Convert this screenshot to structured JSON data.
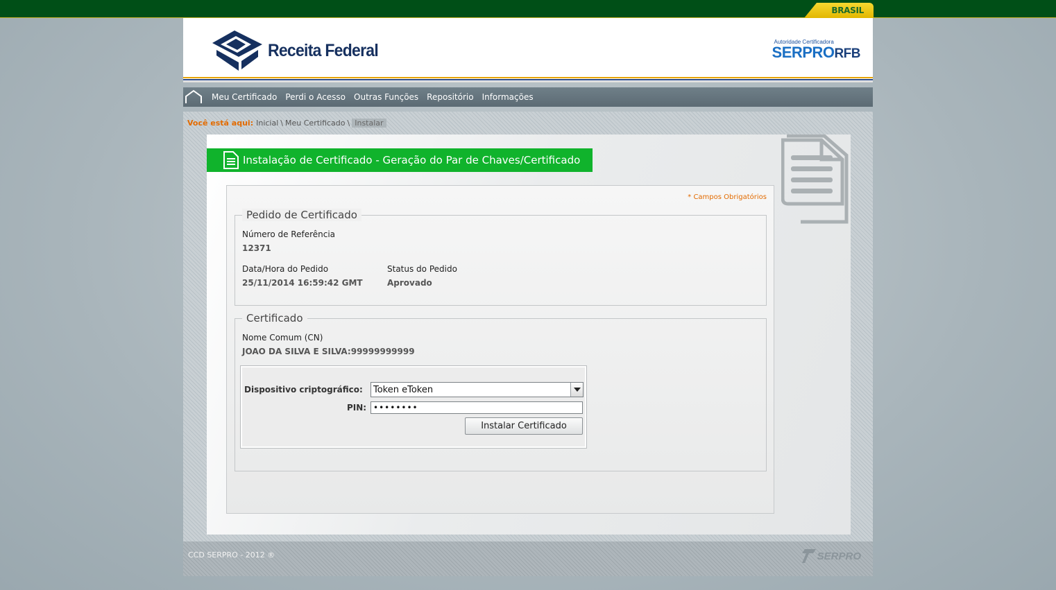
{
  "gov_bar": {
    "label": "BRASIL"
  },
  "header": {
    "logo_text": "Receita Federal",
    "serpro_subtitle": "Autoridade Certificadora",
    "serpro_brand_a": "SERPRO",
    "serpro_brand_b": "RFB"
  },
  "nav": {
    "items": [
      {
        "label": "Meu Certificado"
      },
      {
        "label": "Perdi o Acesso"
      },
      {
        "label": "Outras Funções"
      },
      {
        "label": "Repositório"
      },
      {
        "label": "Informações"
      }
    ]
  },
  "breadcrumb": {
    "label": "Você está aqui:",
    "items": [
      "Inicial",
      "Meu Certificado",
      "Instalar"
    ],
    "separator": "\\"
  },
  "page": {
    "title": "Instalação de Certificado - Geração do Par de Chaves/Certificado",
    "required_note": "* Campos Obrigatórios"
  },
  "pedido": {
    "legend": "Pedido de Certificado",
    "ref_label": "Número de Referência",
    "ref_value": "12371",
    "date_label": "Data/Hora do Pedido",
    "date_value": "25/11/2014 16:59:42 GMT",
    "status_label": "Status do Pedido",
    "status_value": "Aprovado"
  },
  "certificado": {
    "legend": "Certificado",
    "cn_label": "Nome Comum (CN)",
    "cn_value": "JOAO DA SILVA E SILVA:99999999999"
  },
  "crypto": {
    "device_label": "Dispositivo criptográfico:",
    "device_value": "Token eToken",
    "pin_label": "PIN:",
    "pin_value": "••••••••",
    "install_button": "Instalar Certificado"
  },
  "footer": {
    "copyright": "CCD SERPRO - 2012 ®",
    "logo_text": "SERPRO"
  },
  "colors": {
    "gov_green": "#004f17",
    "title_green": "#10b32c",
    "accent_orange": "#e36b00",
    "nav_gray": "#5c6b74"
  }
}
